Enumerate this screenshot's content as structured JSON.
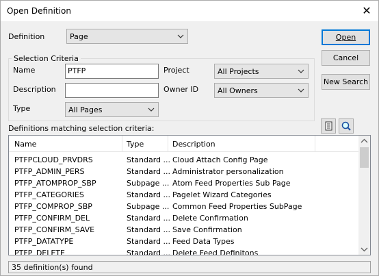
{
  "window": {
    "title": "Open Definition",
    "close_glyph": "✕"
  },
  "definition": {
    "label": "Definition",
    "value": "Page"
  },
  "buttons": {
    "open": "Open",
    "cancel": "Cancel",
    "new_search": "New Search"
  },
  "criteria": {
    "group_title": "Selection Criteria",
    "name_label": "Name",
    "name_value": "PTFP",
    "description_label": "Description",
    "description_value": "",
    "type_label": "Type",
    "type_value": "All Pages",
    "project_label": "Project",
    "project_value": "All Projects",
    "owner_label": "Owner ID",
    "owner_value": "All Owners"
  },
  "results": {
    "label": "Definitions matching selection criteria:",
    "columns": [
      "Name",
      "Type",
      "Description"
    ],
    "rows": [
      [
        "PTFPCLOUD_PRVDRS",
        "Standard ...",
        "Cloud Attach Config Page"
      ],
      [
        "PTFP_ADMIN_PERS",
        "Standard ...",
        "Administrator personalization"
      ],
      [
        "PTFP_ATOMPROP_SBP",
        "Subpage ...",
        "Atom Feed Properties Sub Page"
      ],
      [
        "PTFP_CATEGORIES",
        "Standard ...",
        "Pagelet Wizard Categories"
      ],
      [
        "PTFP_COMPROP_SBP",
        "Subpage ...",
        "Common Feed Properties SubPage"
      ],
      [
        "PTFP_CONFIRM_DEL",
        "Standard ...",
        "Delete Confirmation"
      ],
      [
        "PTFP_CONFIRM_SAVE",
        "Standard ...",
        "Save Confirmation"
      ],
      [
        "PTFP_DATATYPE",
        "Standard ...",
        "Feed Data Types"
      ],
      [
        "PTFP_DELETE",
        "Standard ...",
        "Delete Feed Definitons"
      ]
    ]
  },
  "status": "35 definition(s) found",
  "icons": {
    "properties": "properties-icon",
    "search": "magnifier-icon"
  }
}
